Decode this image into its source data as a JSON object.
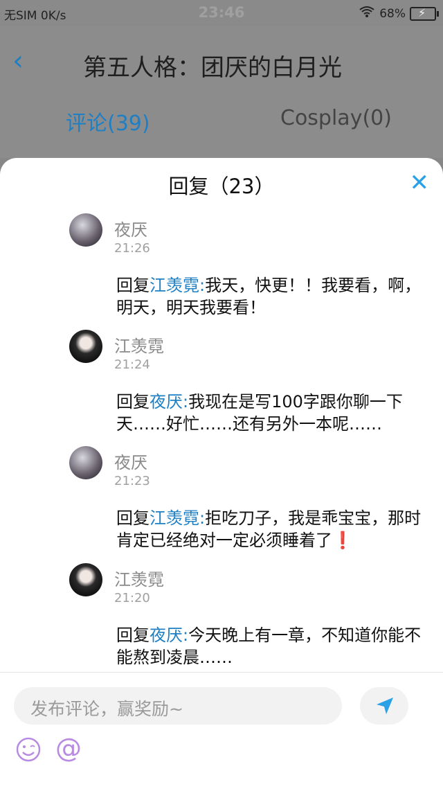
{
  "status": {
    "left_text": "无SIM  0K/s",
    "time": "23:46",
    "battery": "68%"
  },
  "header": {
    "title": "第五人格：团厌的白月光",
    "tabs": [
      {
        "label": "评论(39)"
      },
      {
        "label": "Cosplay(0)"
      }
    ]
  },
  "sheet": {
    "title": "回复（23）",
    "comments": [
      {
        "name": "夜厌",
        "time": "21:26",
        "prefix": "回复",
        "mention": "江羡霓:",
        "text": "我天，快更！！我要看，啊，明天，明天我要看！"
      },
      {
        "name": "江羡霓",
        "time": "21:24",
        "prefix": "回复",
        "mention": "夜厌:",
        "text": "我现在是写100字跟你聊一下天……好忙……还有另外一本呢……"
      },
      {
        "name": "夜厌",
        "time": "21:23",
        "prefix": "回复",
        "mention": "江羡霓:",
        "text": "拒吃刀子，我是乖宝宝，那时肯定已经绝对一定必须睡着了",
        "suffix": "❗"
      },
      {
        "name": "江羡霓",
        "time": "21:20",
        "prefix": "回复",
        "mention": "夜厌:",
        "text": "今天晚上有一章，不知道你能不能熬到凌晨……"
      }
    ],
    "input_placeholder": "发布评论，赢奖励~",
    "at_symbol": "@"
  }
}
